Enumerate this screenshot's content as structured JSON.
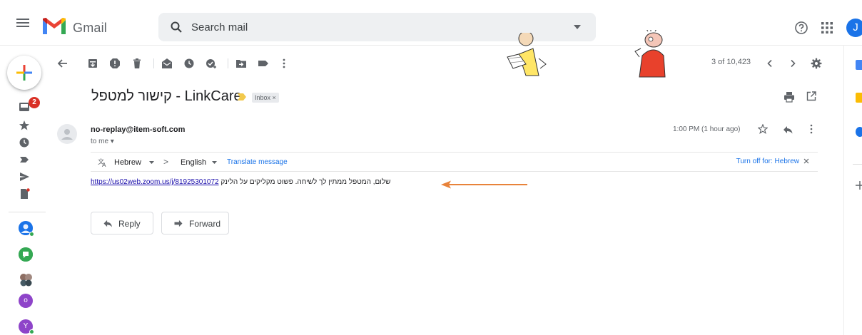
{
  "app": {
    "name": "Gmail"
  },
  "header": {
    "search_placeholder": "Search mail",
    "account_initial": "J"
  },
  "leftrail": {
    "inbox_badge": "2",
    "avatar_o": "o",
    "avatar_y": "Y"
  },
  "toolbar": {
    "pager": "3 of 10,423"
  },
  "message": {
    "subject": "קישור למטפל - LinkCare",
    "label": "Inbox ×",
    "sender": "no-replay@item-soft.com",
    "to": "to me ▾",
    "time": "1:00 PM (1 hour ago)",
    "translate": {
      "from": "Hebrew",
      "arrow": ">",
      "to": "English",
      "action": "Translate message",
      "turn_off": "Turn off for: Hebrew"
    },
    "body_text": "שלום, המטפל ממתין לך לשיחה. פשוט מקליקים על הלינק",
    "body_link": "https://us02web.zoom.us/j/81925301072"
  },
  "actions": {
    "reply": "Reply",
    "forward": "Forward"
  },
  "colors": {
    "annotation_arrow": "#e8833a",
    "badge": "#d93025",
    "link": "#1a0dab",
    "accent": "#1a73e8"
  },
  "icons": [
    "menu-icon",
    "gmail-logo",
    "search-icon",
    "help-icon",
    "apps-icon",
    "compose-icon",
    "inbox-icon",
    "star-icon",
    "clock-icon",
    "important-icon",
    "send-icon",
    "drafts-icon",
    "back-icon",
    "archive-icon",
    "report-spam-icon",
    "delete-icon",
    "mark-unread-icon",
    "snooze-icon",
    "add-task-icon",
    "move-to-icon",
    "label-icon",
    "more-icon",
    "prev-icon",
    "next-icon",
    "settings-icon",
    "print-icon",
    "popout-icon",
    "reply-icon",
    "translate-icon"
  ]
}
